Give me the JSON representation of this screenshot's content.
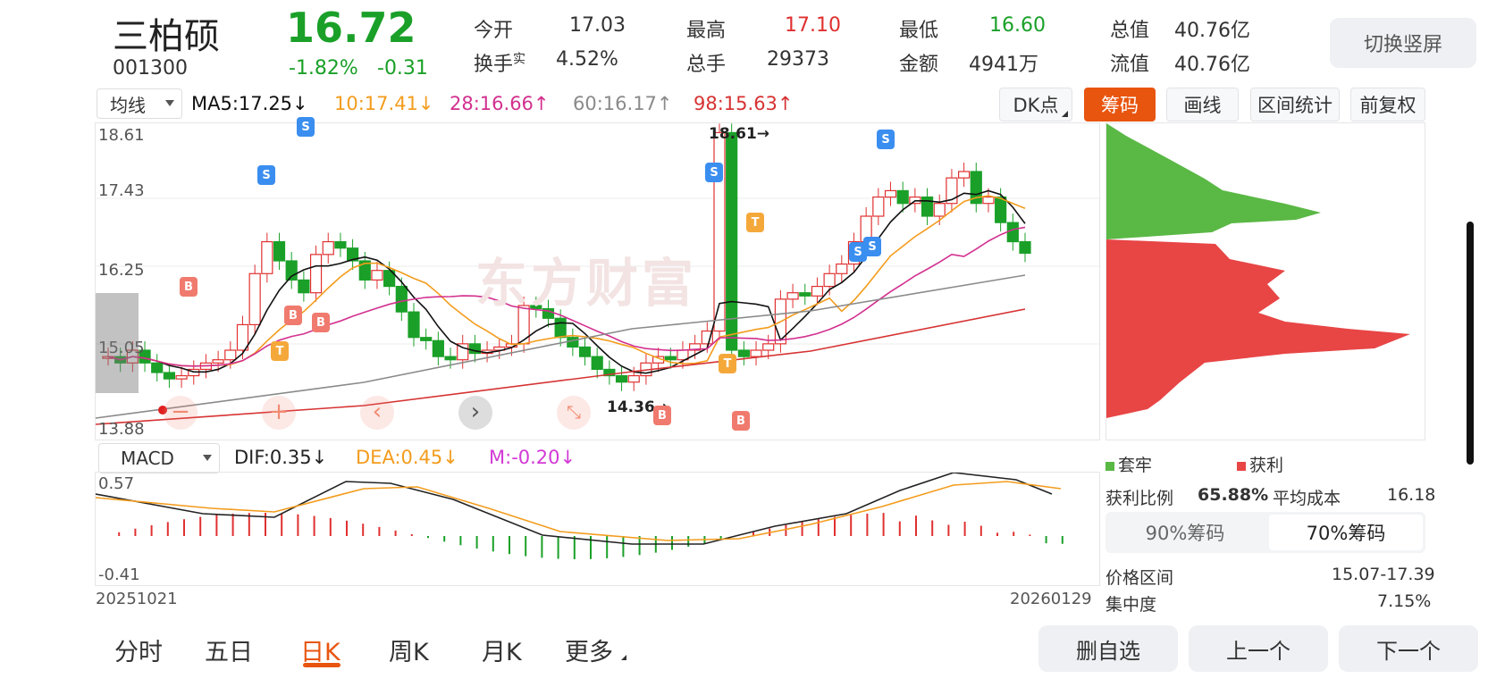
{
  "stock": {
    "name": "三柏硕",
    "code": "001300",
    "price": "16.72",
    "change_pct": "-1.82%",
    "change": "-0.31"
  },
  "quote": {
    "open_label": "今开",
    "open": "17.03",
    "high_label": "最高",
    "high": "17.10",
    "low_label": "最低",
    "low": "16.60",
    "mcap_label": "总值",
    "mcap": "40.76亿",
    "turnover_label": "换手",
    "turnover_sup": "实",
    "turnover": "4.52%",
    "volume_label": "总手",
    "volume": "29373",
    "amount_label": "金额",
    "amount": "4941万",
    "float_label": "流值",
    "float": "40.76亿"
  },
  "switch_button": "切换竖屏",
  "toolbar": {
    "indicator_select": "均线",
    "ma5": "MA5:17.25↓",
    "ma10": "10:17.41↓",
    "ma28": "28:16.66↑",
    "ma60": "60:16.17↑",
    "ma98": "98:15.63↑",
    "dk_button": "DK点",
    "chips_button": "筹码",
    "draw_button": "画线",
    "range_button": "区间统计",
    "adjust_button": "前复权"
  },
  "main_chart": {
    "y_labels": [
      "18.61",
      "17.43",
      "16.25",
      "15.05",
      "13.88"
    ],
    "high_marker": "18.61→",
    "low_marker": "14.36→",
    "watermark": "东方财富"
  },
  "macd": {
    "select": "MACD",
    "dif": "DIF:0.35↓",
    "dea": "DEA:0.45↓",
    "m": "M:-0.20↓",
    "y_top": "0.57",
    "y_bottom": "-0.41",
    "start_date": "20251021",
    "end_date": "20260129"
  },
  "chips": {
    "legend_trapped": "套牢",
    "legend_profit": "获利",
    "profit_ratio_label": "获利比例",
    "profit_ratio": "65.88%",
    "avg_cost_label": "平均成本",
    "avg_cost": "16.18",
    "tab_90": "90%筹码",
    "tab_70": "70%筹码",
    "price_range_label": "价格区间",
    "price_range": "15.07-17.39",
    "concentration_label": "集中度",
    "concentration": "7.15%"
  },
  "bottom_tabs": [
    "分时",
    "五日",
    "日K",
    "周K",
    "月K",
    "更多"
  ],
  "bottom_buttons": {
    "remove": "删自选",
    "prev": "上一个",
    "next": "下一个"
  },
  "colors": {
    "up": "#e03030",
    "down": "#1aa028",
    "accent": "#e8550f",
    "ma5": "#111111",
    "ma10": "#f39c1d",
    "ma28": "#d2308f",
    "ma60": "#8a8a8a",
    "ma98": "#d63333"
  }
}
